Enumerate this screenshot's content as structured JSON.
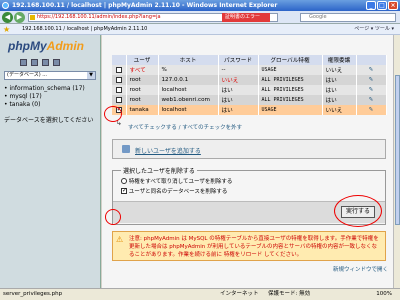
{
  "window": {
    "title": "192.168.100.11 / localhost | phpMyAdmin 2.11.10 - Windows Internet Explorer",
    "min": "_",
    "max": "□",
    "close": "×"
  },
  "address": {
    "url": "https://192.168.100.11/admin/index.php?lang=ja",
    "cert": "証明書のエラー",
    "search_placeholder": "Google"
  },
  "tab": {
    "title": "192.168.100.11 / localhost | phpMyAdmin 2.11.10",
    "tools": "ページ ▾  ツール ▾"
  },
  "left": {
    "logo_main": "phpMy",
    "logo_accent": "Admin",
    "db_select": "(データベース) ...",
    "databases": [
      "information_schema (17)",
      "mysql (17)",
      "tanaka (0)"
    ],
    "choose_db": "データベースを選択してください"
  },
  "users_table": {
    "headers": [
      "",
      "ユーザ",
      "ホスト",
      "パスワード",
      "グローバル特権",
      "権限委譲",
      ""
    ],
    "rows": [
      {
        "user": "すべて",
        "host": "%",
        "password": "--",
        "priv": "USAGE",
        "grant": "いいえ",
        "checked": false,
        "user_red": true,
        "pw_red": false
      },
      {
        "user": "root",
        "host": "127.0.0.1",
        "password": "いいえ",
        "priv": "ALL PRIVILEGES",
        "grant": "はい",
        "checked": false,
        "user_red": false,
        "pw_red": true
      },
      {
        "user": "root",
        "host": "localhost",
        "password": "はい",
        "priv": "ALL PRIVILEGES",
        "grant": "はい",
        "checked": false,
        "user_red": false,
        "pw_red": false
      },
      {
        "user": "root",
        "host": "web1.obenri.com",
        "password": "はい",
        "priv": "ALL PRIVILEGES",
        "grant": "はい",
        "checked": false,
        "user_red": false,
        "pw_red": false
      },
      {
        "user": "tanaka",
        "host": "localhost",
        "password": "はい",
        "priv": "USAGE",
        "grant": "いいえ",
        "checked": true,
        "user_red": false,
        "pw_red": false
      }
    ]
  },
  "check_all": "すべてチェックする / すべてのチェックを外す",
  "add_user": "新しいユーザを追加する",
  "delete": {
    "legend": "選択したユーザを削除する",
    "opt_revoke": "特権をすべて取り消してユーザを削除する",
    "opt_drop_db": "ユーザと同名のデータベースを削除する",
    "exec": "実行する"
  },
  "warning": "注意: phpMyAdmin は MySQL の特権テーブルから直接ユーザの特権を取得します。手作業で特権を更新した場合は phpMyAdmin が利用しているテーブルの内容とサーバの特権の内容が一致しなくなることがあります。作業を続ける前に 特権をリロード してください。",
  "new_window": "新規ウィンドウで開く",
  "status": {
    "left": "server_privileges.php",
    "zone": "インターネット",
    "mode": "保護モード: 無効",
    "zoom": "100%"
  }
}
